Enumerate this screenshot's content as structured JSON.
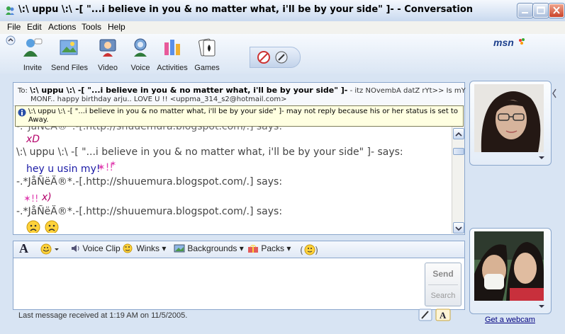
{
  "window": {
    "title": "\\:\\ uppu \\:\\ -[ \"...i believe in you & no matter what, i'll be by your side\" ]- - Conversation"
  },
  "menu": [
    "File",
    "Edit",
    "Actions",
    "Tools",
    "Help"
  ],
  "toolbar": {
    "buttons": [
      {
        "label": "Invite",
        "icon": "invite-icon"
      },
      {
        "label": "Send Files",
        "icon": "send-files-icon"
      },
      {
        "label": "Video",
        "icon": "video-icon"
      },
      {
        "label": "Voice",
        "icon": "voice-icon"
      },
      {
        "label": "Activities",
        "icon": "activities-icon"
      },
      {
        "label": "Games",
        "icon": "games-icon"
      }
    ],
    "logo": "msn"
  },
  "to": {
    "prefix": "To:",
    "name": "\\:\\ uppu \\:\\ -[ \"...i believe in you & no matter what, i'll be by your side\" ]-",
    "status_msg": "- itz NOvembA datZ rYt>> Is mY",
    "line2": "MONF.. happy birthday arju.. LOVE U !! <uppma_314_s2@hotmail.com>"
  },
  "warning": {
    "line1": "\\:\\ uppu \\:\\ -[ \"...i believe in you & no matter what, i'll be by your side\" ]- may not reply because his or her status is set to",
    "line2": "Away."
  },
  "messages": [
    {
      "type": "says",
      "text": "-.*JåÑëÄ®*.-[.http://shuuemura.blogspot.com/.] says:"
    },
    {
      "type": "msg",
      "text": "xD",
      "color": "#b4006a"
    },
    {
      "type": "says",
      "text": "\\:\\ uppu \\:\\ -[ \"...i believe in you & no matter what, i'll be by your side\" ]- says:"
    },
    {
      "type": "msg",
      "text": "hey u usin my!",
      "color": "#1a1aa6"
    },
    {
      "type": "says",
      "text": "-.*JåÑëÄ®*.-[.http://shuuemura.blogspot.com/.] says:"
    },
    {
      "type": "msg",
      "text": "x)",
      "color": "#b4006a"
    },
    {
      "type": "says",
      "text": "-.*JåÑëÄ®*.-[.http://shuuemura.blogspot.com/.] says:"
    }
  ],
  "format_bar": {
    "voice_clip": "Voice Clip",
    "winks": "Winks",
    "backgrounds": "Backgrounds",
    "packs": "Packs"
  },
  "send": {
    "send_label": "Send",
    "search_label": "Search"
  },
  "status": {
    "text": "Last message received at 1:19 AM on 11/5/2005."
  },
  "webcam_link": "Get a webcam",
  "colors": {
    "accent": "#8aa6cc",
    "warning_bg": "#ffffe1"
  }
}
